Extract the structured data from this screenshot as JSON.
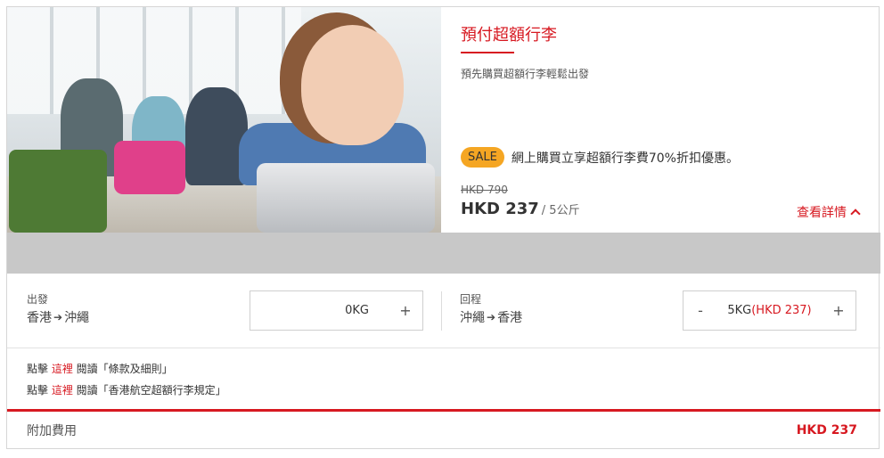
{
  "product": {
    "title": "預付超額行李",
    "subtitle": "預先購買超額行李輕鬆出發",
    "sale_badge": "SALE",
    "sale_text": "網上購買立享超額行李費70%折扣優惠。",
    "old_price": "HKD 790",
    "price": "HKD 237",
    "unit": "/ 5公斤",
    "details_link": "查看詳情"
  },
  "outbound": {
    "label": "出發",
    "from": "香港",
    "to": "沖繩",
    "value": "0KG",
    "fee": "",
    "minus_label": "",
    "plus_label": "+"
  },
  "return": {
    "label": "回程",
    "from": "沖繩",
    "to": "香港",
    "value": "5KG",
    "fee": "(HKD 237)",
    "minus_label": "-",
    "plus_label": "+"
  },
  "terms": [
    {
      "prefix": "點擊 ",
      "link": "這裡",
      "suffix": " 閱讀「條款及細則」"
    },
    {
      "prefix": "點擊 ",
      "link": "這裡",
      "suffix": " 閱讀「香港航空超額行李規定」"
    }
  ],
  "footer": {
    "label": "附加費用",
    "total": "HKD 237"
  },
  "colors": {
    "accent": "#d71921",
    "sale_badge": "#f5a623"
  }
}
